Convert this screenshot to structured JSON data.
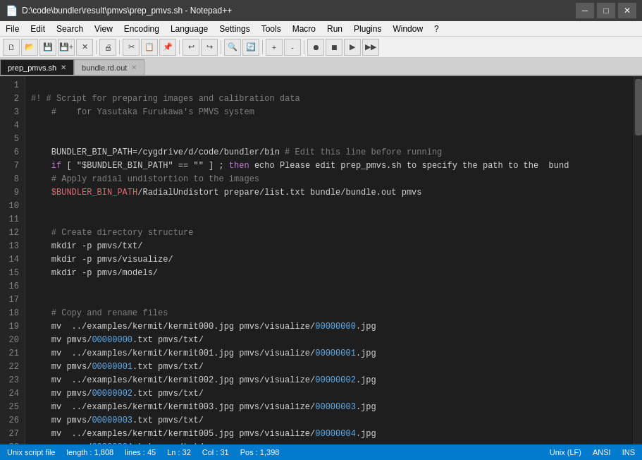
{
  "titlebar": {
    "icon": "📄",
    "title": "D:\\code\\bundler\\result\\pmvs\\prep_pmvs.sh - Notepad++",
    "min": "─",
    "max": "□",
    "close": "✕"
  },
  "menubar": {
    "items": [
      "File",
      "Edit",
      "Search",
      "View",
      "Encoding",
      "Language",
      "Settings",
      "Tools",
      "Macro",
      "Run",
      "Plugins",
      "Window",
      "?"
    ]
  },
  "tabs": [
    {
      "label": "prep_pmvs.sh",
      "active": true
    },
    {
      "label": "bundle.rd.out",
      "active": false
    }
  ],
  "statusbar": {
    "filetype": "Unix script file",
    "length": "length : 1,808",
    "lines": "lines : 45",
    "ln": "Ln : 32",
    "col": "Col : 31",
    "pos": "Pos : 1,398",
    "eol": "Unix (LF)",
    "encoding": "ANSI",
    "ins": "INS"
  }
}
